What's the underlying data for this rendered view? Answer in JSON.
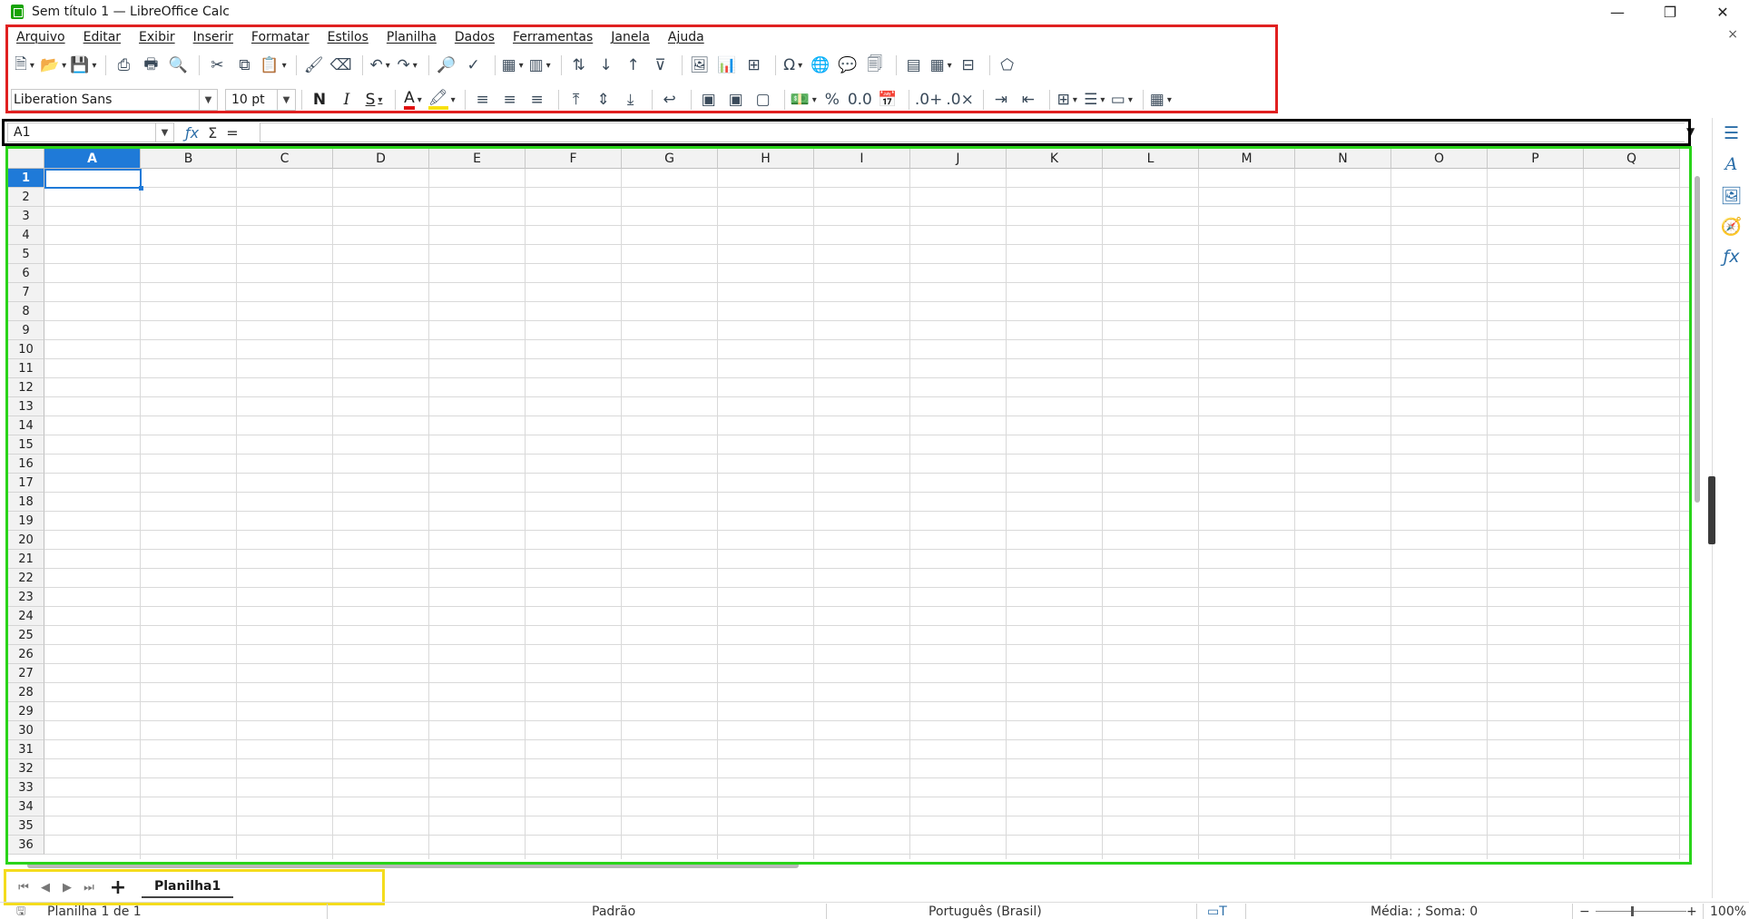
{
  "window": {
    "title": "Sem título 1 — LibreOffice Calc",
    "minimize": "—",
    "maximize": "❐",
    "close": "✕",
    "doc_close": "×"
  },
  "menu": [
    "Arquivo",
    "Editar",
    "Exibir",
    "Inserir",
    "Formatar",
    "Estilos",
    "Planilha",
    "Dados",
    "Ferramentas",
    "Janela",
    "Ajuda"
  ],
  "toolbar1": [
    {
      "name": "new-icon",
      "glyph": "🗎",
      "dd": true
    },
    {
      "name": "open-icon",
      "glyph": "📂",
      "dd": true
    },
    {
      "name": "save-icon",
      "glyph": "💾",
      "dd": true
    },
    {
      "sep": true
    },
    {
      "name": "export-pdf-icon",
      "glyph": "⎙",
      "dd": false
    },
    {
      "name": "print-icon",
      "glyph": "🖶",
      "dd": false
    },
    {
      "name": "print-preview-icon",
      "glyph": "🔍",
      "dd": false
    },
    {
      "sep": true
    },
    {
      "name": "cut-icon",
      "glyph": "✂",
      "dd": false
    },
    {
      "name": "copy-icon",
      "glyph": "⧉",
      "dd": false
    },
    {
      "name": "paste-icon",
      "glyph": "📋",
      "dd": true
    },
    {
      "sep": true
    },
    {
      "name": "clone-formatting-icon",
      "glyph": "🖌",
      "dd": false
    },
    {
      "name": "clear-formatting-icon",
      "glyph": "⌫",
      "dd": false
    },
    {
      "sep": true
    },
    {
      "name": "undo-icon",
      "glyph": "↶",
      "dd": true
    },
    {
      "name": "redo-icon",
      "glyph": "↷",
      "dd": true
    },
    {
      "sep": true
    },
    {
      "name": "find-replace-icon",
      "glyph": "🔎",
      "dd": false
    },
    {
      "name": "spelling-icon",
      "glyph": "✓",
      "dd": false
    },
    {
      "sep": true
    },
    {
      "name": "row-icon",
      "glyph": "▦",
      "dd": true
    },
    {
      "name": "column-icon",
      "glyph": "▥",
      "dd": true
    },
    {
      "sep": true
    },
    {
      "name": "sort-icon",
      "glyph": "⇅",
      "dd": false
    },
    {
      "name": "sort-ascending-icon",
      "glyph": "↓",
      "dd": false
    },
    {
      "name": "sort-descending-icon",
      "glyph": "↑",
      "dd": false
    },
    {
      "name": "autofilter-icon",
      "glyph": "⊽",
      "dd": false
    },
    {
      "sep": true
    },
    {
      "name": "insert-image-icon",
      "glyph": "🖼",
      "dd": false
    },
    {
      "name": "insert-chart-icon",
      "glyph": "📊",
      "dd": false
    },
    {
      "name": "pivot-table-icon",
      "glyph": "⊞",
      "dd": false
    },
    {
      "sep": true
    },
    {
      "name": "special-character-icon",
      "glyph": "Ω",
      "dd": true
    },
    {
      "name": "hyperlink-icon",
      "glyph": "🌐",
      "dd": false
    },
    {
      "name": "comment-icon",
      "glyph": "💬",
      "dd": false
    },
    {
      "name": "header-footer-icon",
      "glyph": "🗐",
      "dd": false
    },
    {
      "sep": true
    },
    {
      "name": "define-print-area-icon",
      "glyph": "▤",
      "dd": false
    },
    {
      "name": "freeze-rows-columns-icon",
      "glyph": "▦",
      "dd": true
    },
    {
      "name": "split-window-icon",
      "glyph": "⊟",
      "dd": false
    },
    {
      "sep": true
    },
    {
      "name": "show-draw-functions-icon",
      "glyph": "⬠",
      "dd": false
    }
  ],
  "toolbar2": {
    "font_name": "Liberation Sans",
    "font_size": "10 pt",
    "bold": "N",
    "italic": "I",
    "underline": "S",
    "font_color_glyph": "A",
    "highlight_glyph": "🖍",
    "buttons": [
      {
        "sep": true
      },
      {
        "name": "align-left-icon",
        "glyph": "≡",
        "dd": false
      },
      {
        "name": "align-center-icon",
        "glyph": "≡",
        "dd": false
      },
      {
        "name": "align-right-icon",
        "glyph": "≡",
        "dd": false
      },
      {
        "sep": true
      },
      {
        "name": "align-top-icon",
        "glyph": "⤒",
        "dd": false
      },
      {
        "name": "align-middle-icon",
        "glyph": "⇕",
        "dd": false
      },
      {
        "name": "align-bottom-icon",
        "glyph": "⤓",
        "dd": false
      },
      {
        "sep": true
      },
      {
        "name": "wrap-text-icon",
        "glyph": "↩",
        "dd": false
      },
      {
        "sep": true
      },
      {
        "name": "merge-center-icon",
        "glyph": "▣",
        "dd": false
      },
      {
        "name": "merge-cells-icon",
        "glyph": "▣",
        "dd": false
      },
      {
        "name": "unmerge-cells-icon",
        "glyph": "▢",
        "dd": false
      },
      {
        "sep": true
      },
      {
        "name": "currency-format-icon",
        "glyph": "💵",
        "dd": true
      },
      {
        "name": "percent-format-icon",
        "glyph": "%",
        "dd": false
      },
      {
        "name": "number-format-icon",
        "glyph": "0.0",
        "dd": false
      },
      {
        "name": "date-format-icon",
        "glyph": "📅",
        "dd": false
      },
      {
        "sep": true
      },
      {
        "name": "add-decimal-icon",
        "glyph": ".0+",
        "dd": false
      },
      {
        "name": "delete-decimal-icon",
        "glyph": ".0×",
        "dd": false
      },
      {
        "sep": true
      },
      {
        "name": "increase-indent-icon",
        "glyph": "⇥",
        "dd": false
      },
      {
        "name": "decrease-indent-icon",
        "glyph": "⇤",
        "dd": false
      },
      {
        "sep": true
      },
      {
        "name": "borders-icon",
        "glyph": "⊞",
        "dd": true
      },
      {
        "name": "border-style-icon",
        "glyph": "☰",
        "dd": true
      },
      {
        "name": "border-color-icon",
        "glyph": "▭",
        "dd": true
      },
      {
        "sep": true
      },
      {
        "name": "conditional-format-icon",
        "glyph": "▦",
        "dd": true
      }
    ]
  },
  "formula_bar": {
    "name_box": "A1",
    "fx": "ƒx",
    "sum": "Σ",
    "equals": "=",
    "content": ""
  },
  "grid": {
    "columns": [
      "A",
      "B",
      "C",
      "D",
      "E",
      "F",
      "G",
      "H",
      "I",
      "J",
      "K",
      "L",
      "M",
      "N",
      "O",
      "P",
      "Q"
    ],
    "rows": [
      "1",
      "2",
      "3",
      "4",
      "5",
      "6",
      "7",
      "8",
      "9",
      "10",
      "11",
      "12",
      "13",
      "14",
      "15",
      "16",
      "17",
      "18",
      "19",
      "20",
      "21",
      "22",
      "23",
      "24",
      "25",
      "26",
      "27",
      "28",
      "29",
      "30",
      "31",
      "32",
      "33",
      "34",
      "35",
      "36"
    ],
    "active_column": "A",
    "active_row": "1"
  },
  "sidebar": [
    {
      "name": "properties-icon",
      "glyph": "☰"
    },
    {
      "name": "styles-icon",
      "glyph": "A"
    },
    {
      "name": "gallery-icon",
      "glyph": "🖼"
    },
    {
      "name": "navigator-icon",
      "glyph": "🧭"
    },
    {
      "name": "functions-icon",
      "glyph": "ƒx"
    }
  ],
  "sheets": {
    "first": "⏮",
    "prev": "◀",
    "next": "▶",
    "last": "⏭",
    "add": "+",
    "tabs": [
      "Planilha1"
    ]
  },
  "status": {
    "sheet_info": "Planilha 1 de 1",
    "page_style": "Padrão",
    "language": "Português (Brasil)",
    "selection_mode": "▭T",
    "sum_info": "Média: ; Soma: 0",
    "zoom_minus": "−",
    "zoom_plus": "+",
    "zoom": "100%"
  }
}
